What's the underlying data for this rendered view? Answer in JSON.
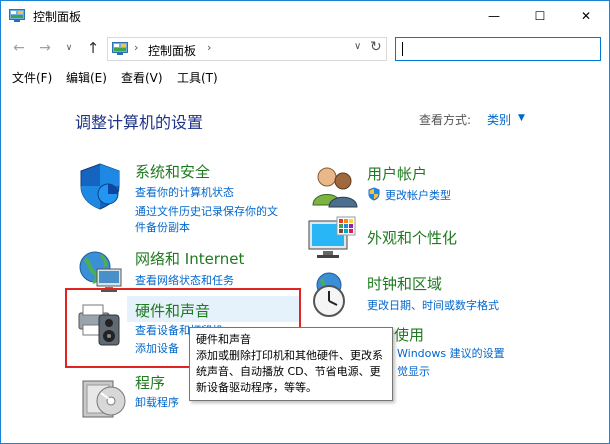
{
  "window": {
    "title": "控制面板",
    "minimize_glyph": "—",
    "maximize_glyph": "☐",
    "close_glyph": "✕"
  },
  "nav": {
    "back_glyph": "←",
    "forward_glyph": "→",
    "history_glyph": "∨",
    "up_glyph": "↑",
    "separator_glyph": "›",
    "dropdown_glyph": "∨",
    "refresh_glyph": "↻",
    "address": "控制面板",
    "search_value": ""
  },
  "menu": {
    "items": [
      "文件(F)",
      "编辑(E)",
      "查看(V)",
      "工具(T)"
    ]
  },
  "main": {
    "title": "调整计算机的设置",
    "view_label": "查看方式:",
    "view_value": "类别",
    "view_caret": "▼"
  },
  "categories": {
    "system_security": {
      "title": "系统和安全",
      "links": [
        "查看你的计算机状态",
        "通过文件历史记录保存你的文",
        "件备份副本"
      ]
    },
    "network": {
      "title": "网络和 Internet",
      "links": [
        "查看网络状态和任务"
      ]
    },
    "hardware": {
      "title": "硬件和声音",
      "links": [
        "查看设备和打印机",
        "添加设备"
      ]
    },
    "programs": {
      "title": "程序",
      "links": [
        "卸载程序"
      ]
    },
    "user_accounts": {
      "title": "用户帐户",
      "links": [
        "更改帐户类型"
      ]
    },
    "appearance": {
      "title": "外观和个性化"
    },
    "clock_region": {
      "title": "时钟和区域",
      "links": [
        "更改日期、时间或数字格式"
      ]
    },
    "ease_access": {
      "title": "松使用",
      "links": [
        "Windows 建议的设置",
        "觉显示"
      ]
    }
  },
  "tooltip": {
    "title": "硬件和声音",
    "body": "添加或删除打印机和其他硬件、更改系统声音、自动播放 CD、节省电源、更新设备驱动程序，等等。"
  },
  "colors": {
    "category_title": "#1f7a1f",
    "link": "#0066cc",
    "page_title": "#1e3287",
    "highlight_box": "#e02424",
    "hover_background": "#e5f1fb"
  }
}
